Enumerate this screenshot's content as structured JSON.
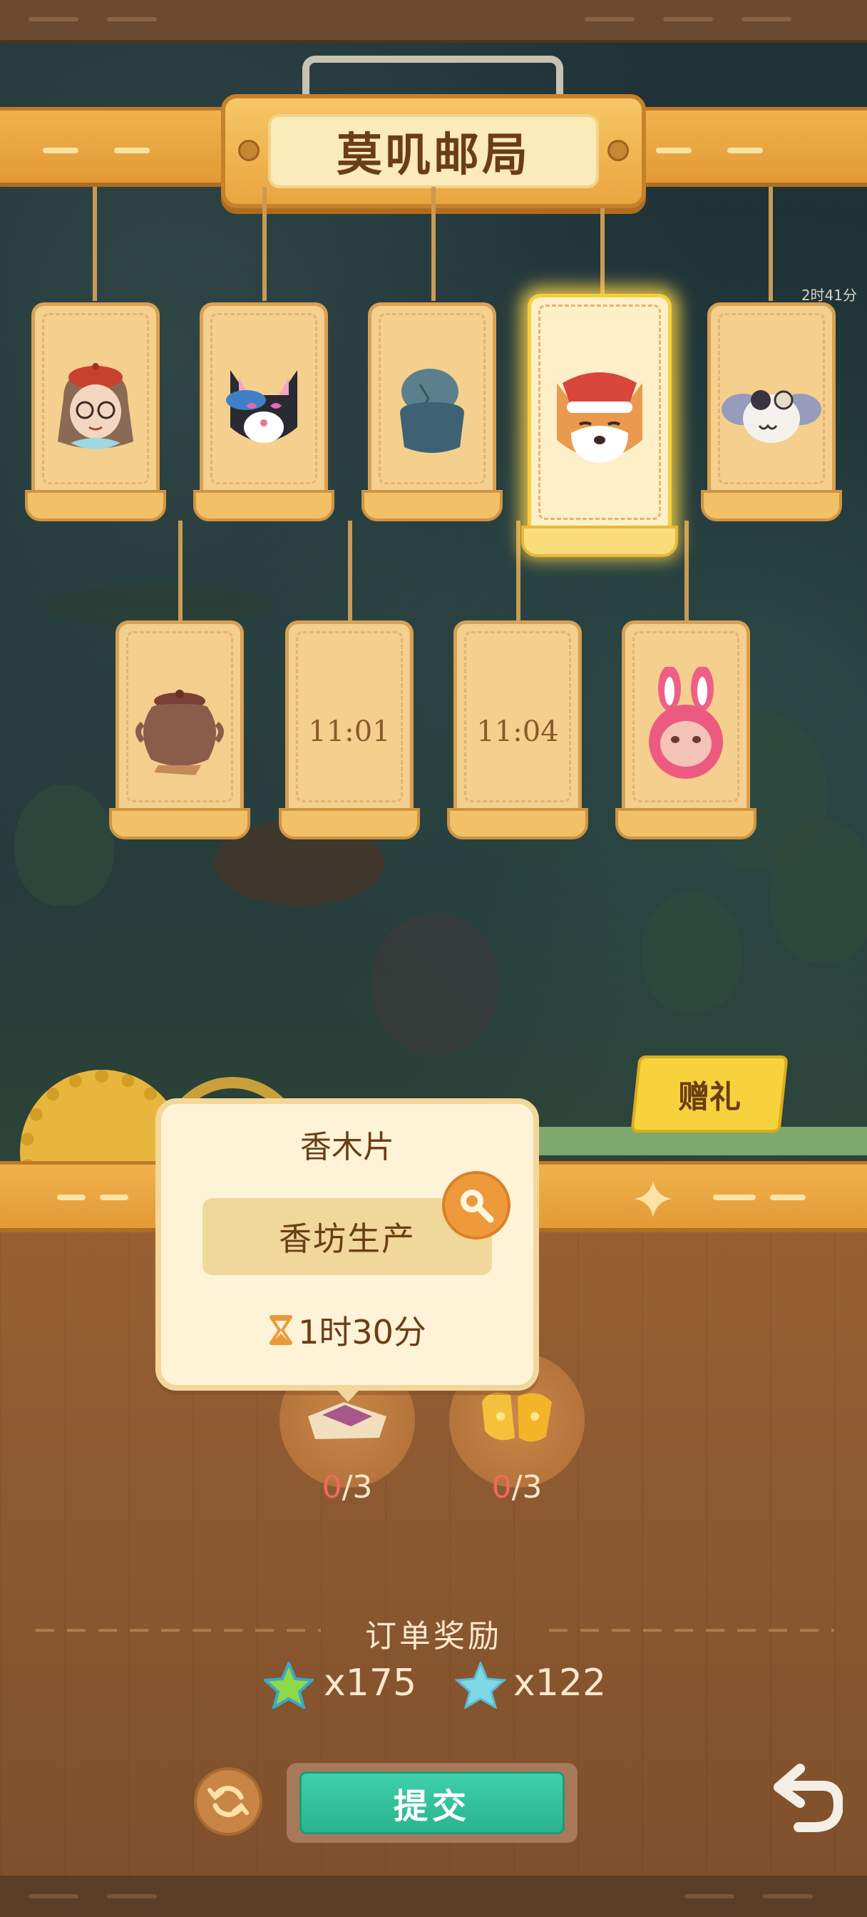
{
  "header": {
    "title": "莫叽邮局"
  },
  "order_cards": [
    {
      "kind": "character",
      "icon": "grandma-beret-icon",
      "active": false
    },
    {
      "kind": "character",
      "icon": "black-cat-sunglasses-icon",
      "active": false
    },
    {
      "kind": "item",
      "icon": "blue-stone-pot-icon",
      "active": false
    },
    {
      "kind": "character",
      "icon": "corgi-santa-hat-icon",
      "active": true
    },
    {
      "kind": "character",
      "icon": "clockwork-bug-icon",
      "active": false
    },
    {
      "kind": "item",
      "icon": "clay-jar-icon",
      "active": false
    },
    {
      "kind": "timer",
      "time": "11:01",
      "active": false
    },
    {
      "kind": "timer",
      "time": "11:04",
      "active": false
    },
    {
      "kind": "character",
      "icon": "pink-bunny-hood-icon",
      "active": false
    }
  ],
  "background_timer": "2时41分",
  "gift": {
    "label": "赠礼"
  },
  "popup": {
    "item_name": "香木片",
    "source_label": "香坊生产",
    "duration": "1时30分"
  },
  "ingredients": [
    {
      "icon": "fabric-cushion-icon",
      "have": "0",
      "need": "/3"
    },
    {
      "icon": "yellow-bread-icon",
      "have": "0",
      "need": "/3"
    }
  ],
  "reward": {
    "title": "订单奖励",
    "items": [
      {
        "icon": "green-star-icon",
        "amount": "x175",
        "color": "#8fd84a"
      },
      {
        "icon": "blue-star-icon",
        "amount": "x122",
        "color": "#7fd8e6"
      }
    ]
  },
  "buttons": {
    "submit": "提交"
  },
  "colors": {
    "wood_dark": "#6b4a2f",
    "sign_gold": "#f0b24d",
    "submit_green": "#3fd0aa",
    "highlight_glow": "#ffd646",
    "count_red": "#f06a5d"
  }
}
